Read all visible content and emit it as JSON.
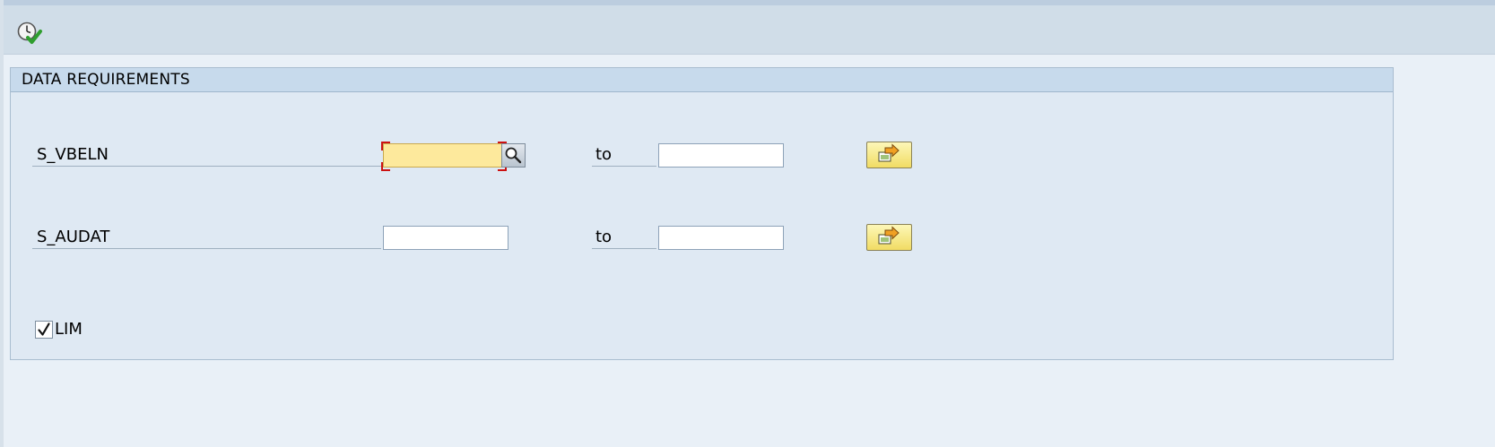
{
  "toolbar": {
    "execute_icon": "execute-clock-check-icon"
  },
  "group": {
    "title": "DATA REQUIREMENTS",
    "rows": [
      {
        "label": "S_VBELN",
        "low_value": "",
        "to_label": "to",
        "high_value": ""
      },
      {
        "label": "S_AUDAT",
        "low_value": "",
        "to_label": "to",
        "high_value": ""
      }
    ],
    "checkbox": {
      "label": "LIM",
      "checked": true
    }
  },
  "icons": {
    "search_help": "magnifier-icon",
    "multiple_selection": "arrow-right-icon"
  },
  "colors": {
    "focused_field_bg": "#fde99c",
    "focus_corner": "#cc1111",
    "multi_btn": "#f1dc63",
    "group_header": "#c7daec"
  }
}
